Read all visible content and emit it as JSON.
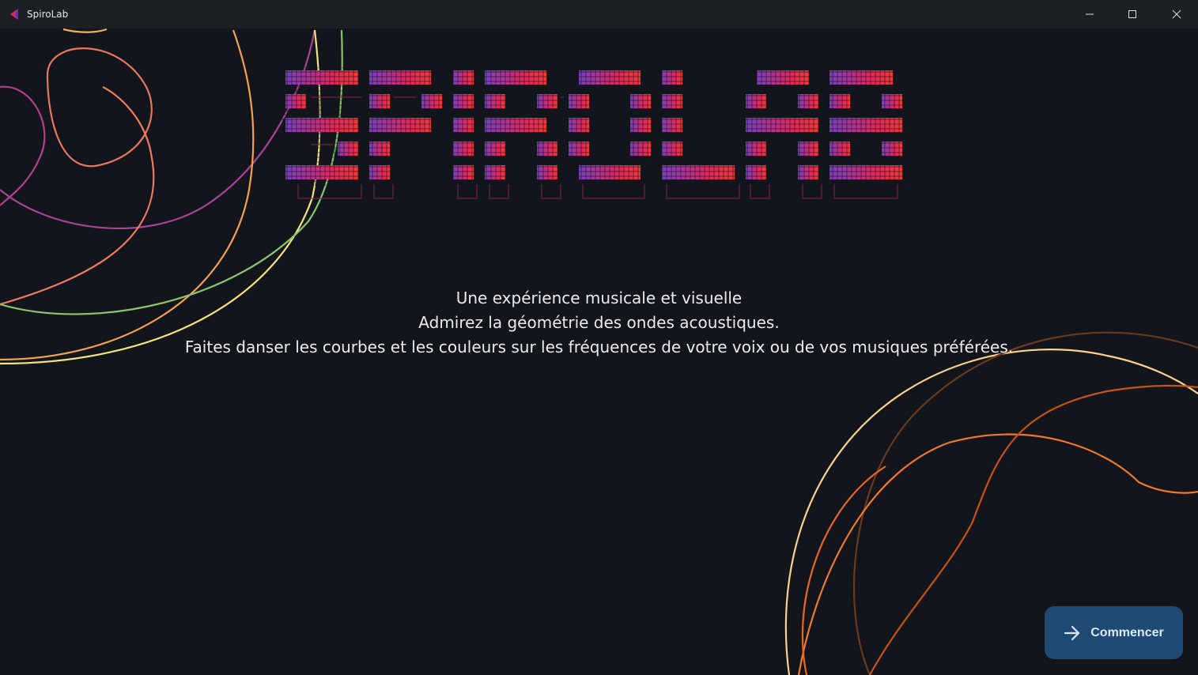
{
  "window": {
    "title": "SpiroLab",
    "controls": [
      "minimize-icon",
      "maximize-icon",
      "close-icon"
    ]
  },
  "logo": {
    "text": "SPIROLAB",
    "gradient": [
      "#7a3fc0",
      "#c42b8e",
      "#e8265a",
      "#f03a3a"
    ]
  },
  "tagline": {
    "line1": "Une expérience musicale et visuelle",
    "line2": "Admirez la géométrie des ondes acoustiques.",
    "line3": "Faites danser les courbes et les couleurs sur les fréquences de votre voix ou de vos musiques préférées."
  },
  "start_button": {
    "label": "Commencer",
    "icon": "arrow-right-icon"
  },
  "colors": {
    "background": "#12151b",
    "titlebar": "#1c1f24",
    "button": "#1e4a73"
  }
}
